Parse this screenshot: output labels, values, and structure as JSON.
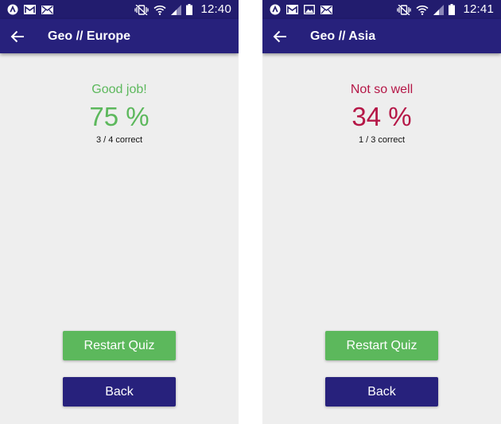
{
  "colors": {
    "status_bar": "#221c6e",
    "app_bar": "#27217c",
    "background": "#eeeeee",
    "success": "#5cb85c",
    "failure": "#b51747",
    "back_button": "#27217c"
  },
  "screens": [
    {
      "status_bar": {
        "notification_icons": [
          "app-icon",
          "gmail-icon",
          "mail-icon"
        ],
        "system_icons": [
          "vibrate-icon",
          "wifi-icon",
          "signal-icon",
          "battery-icon"
        ],
        "time": "12:40"
      },
      "app_bar": {
        "back_icon": "arrow-back-icon",
        "title": "Geo // Europe"
      },
      "result": {
        "verdict": "Good job!",
        "percent": "75 %",
        "score": "3 / 4 correct",
        "color": "#5cb85c"
      },
      "buttons": {
        "restart": "Restart Quiz",
        "back": "Back"
      }
    },
    {
      "status_bar": {
        "notification_icons": [
          "app-icon",
          "gmail-icon",
          "image-icon",
          "mail-icon"
        ],
        "system_icons": [
          "vibrate-icon",
          "wifi-icon",
          "signal-icon",
          "battery-icon"
        ],
        "time": "12:41"
      },
      "app_bar": {
        "back_icon": "arrow-back-icon",
        "title": "Geo // Asia"
      },
      "result": {
        "verdict": "Not so well",
        "percent": "34 %",
        "score": "1 / 3 correct",
        "color": "#b51747"
      },
      "buttons": {
        "restart": "Restart Quiz",
        "back": "Back"
      }
    }
  ]
}
